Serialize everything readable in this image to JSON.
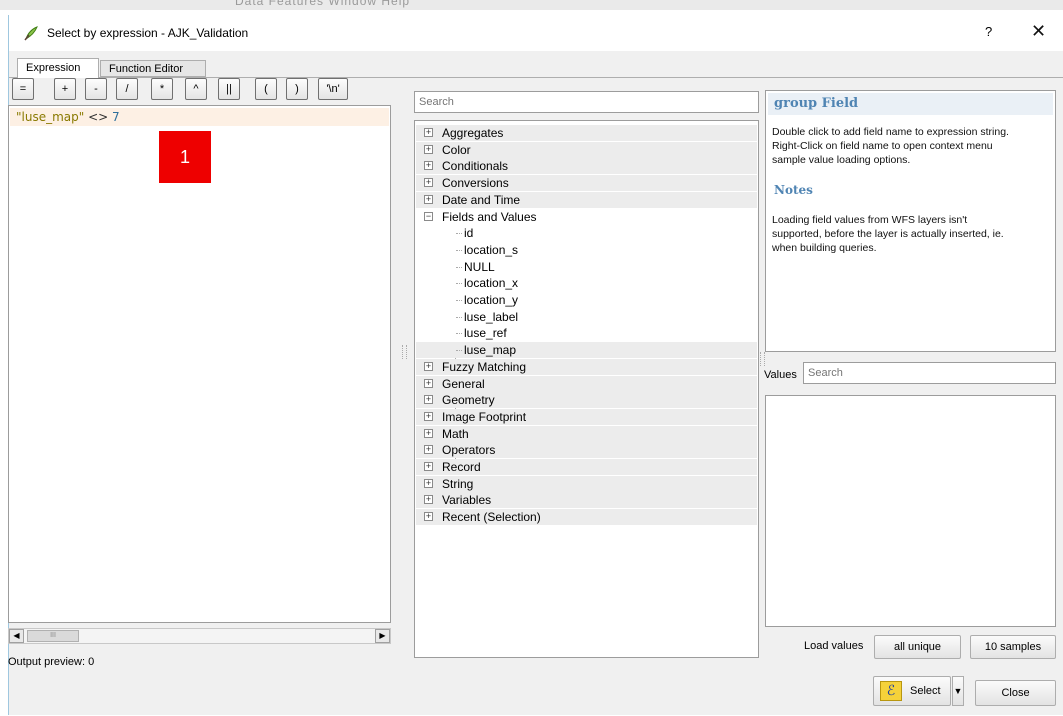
{
  "window": {
    "title": "Select by expression - AJK_Validation",
    "help": "?",
    "close_symbol": "✕",
    "background_menu": "Data   Features   Window   Help"
  },
  "tabs": [
    {
      "label": "Expression",
      "active": true
    },
    {
      "label": "Function Editor",
      "active": false
    }
  ],
  "operators": [
    "=",
    "+",
    "-",
    "/",
    "*",
    "^",
    "||",
    "(",
    ")",
    "'\\n'"
  ],
  "expression": {
    "field": "\"luse_map\"",
    "operator": "<>",
    "value": "7"
  },
  "annotation_marker": "1",
  "output_preview": "Output preview:  0",
  "function_search": {
    "placeholder": "Search"
  },
  "function_tree": {
    "groups": [
      {
        "label": "Aggregates",
        "expanded": false
      },
      {
        "label": "Color",
        "expanded": false
      },
      {
        "label": "Conditionals",
        "expanded": false
      },
      {
        "label": "Conversions",
        "expanded": false
      },
      {
        "label": "Date and Time",
        "expanded": false
      },
      {
        "label": "Fields and Values",
        "expanded": true,
        "children": [
          "id",
          "location_s",
          "NULL",
          "location_x",
          "location_y",
          "luse_label",
          "luse_ref",
          "luse_map"
        ]
      },
      {
        "label": "Fuzzy Matching",
        "expanded": false
      },
      {
        "label": "General",
        "expanded": false
      },
      {
        "label": "Geometry",
        "expanded": false
      },
      {
        "label": "Image Footprint",
        "expanded": false
      },
      {
        "label": "Math",
        "expanded": false
      },
      {
        "label": "Operators",
        "expanded": false
      },
      {
        "label": "Record",
        "expanded": false
      },
      {
        "label": "String",
        "expanded": false
      },
      {
        "label": "Variables",
        "expanded": false
      },
      {
        "label": "Recent (Selection)",
        "expanded": false
      }
    ],
    "selected_item": "luse_map"
  },
  "help_panel": {
    "heading": "group Field",
    "text_line1": "Double click to add field name to expression string.",
    "text_line2": "Right-Click on field name to open context menu",
    "text_line3": "sample value loading options.",
    "notes_heading": "Notes",
    "notes_line1": "Loading field values from WFS layers isn't",
    "notes_line2": "supported, before the layer is actually inserted, ie.",
    "notes_line3": "when building queries."
  },
  "values": {
    "label": "Values",
    "search_placeholder": "Search",
    "load_label": "Load values",
    "all_unique": "all unique",
    "samples": "10 samples"
  },
  "buttons": {
    "select": "Select",
    "close": "Close"
  },
  "colors": {
    "heading_blue": "#4f84b3",
    "field_string": "#8a7a00",
    "number": "#2e6f9c",
    "marker_red": "#ee0000"
  }
}
